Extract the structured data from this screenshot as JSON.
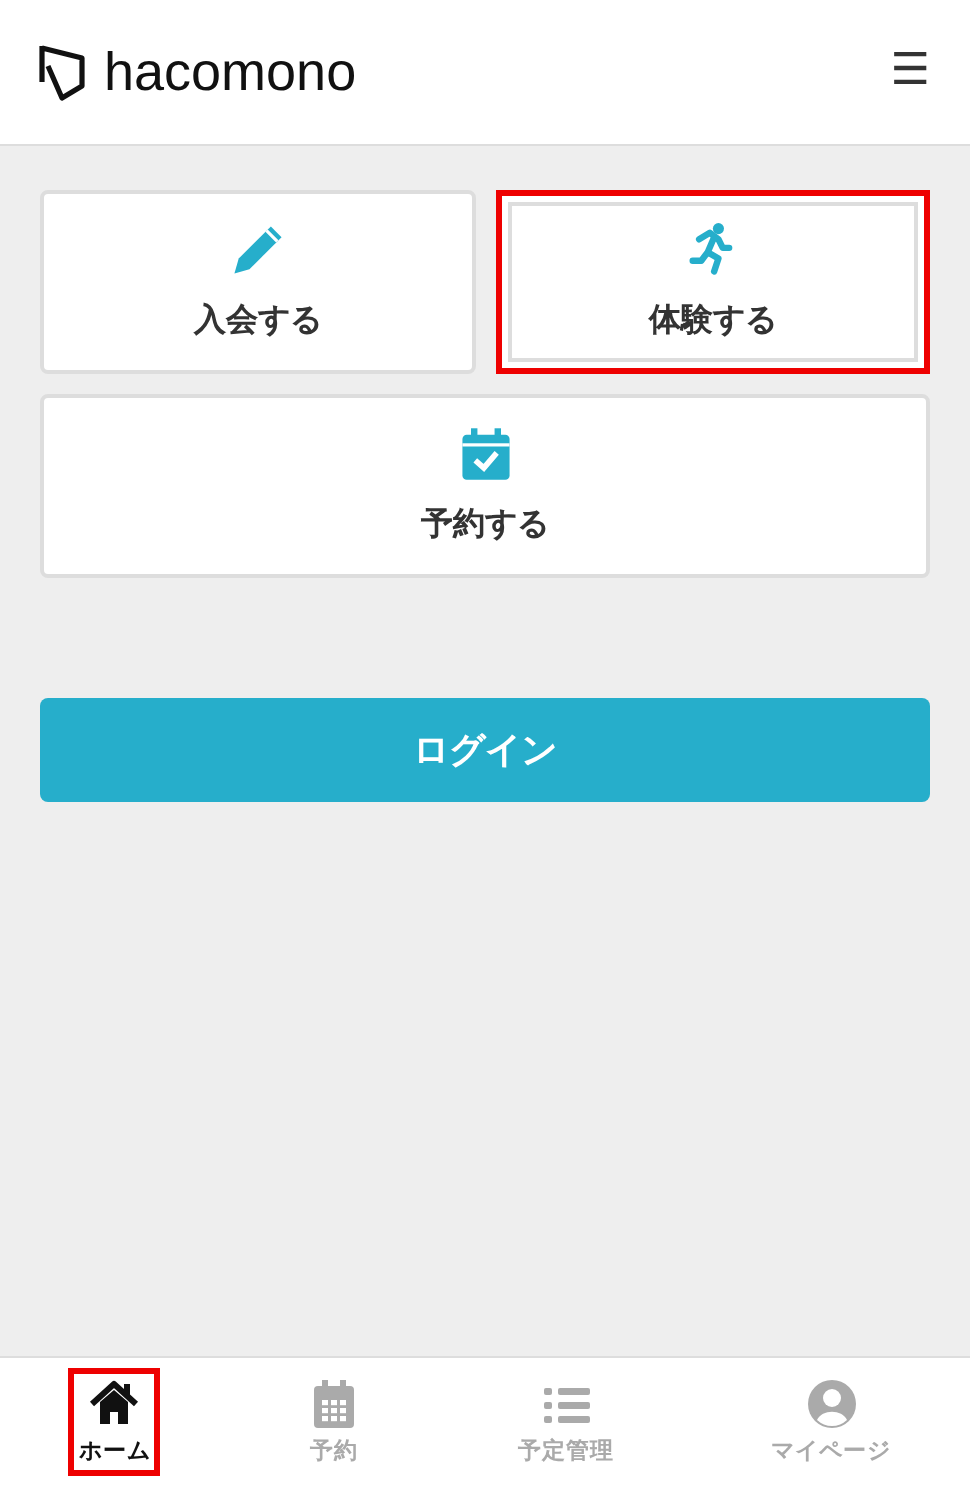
{
  "header": {
    "logo_text": "hacomono",
    "menu_icon": "☰"
  },
  "actions": [
    {
      "label": "入会する",
      "kind": "pencil",
      "highlighted": false,
      "wide": false
    },
    {
      "label": "体験する",
      "kind": "runner",
      "highlighted": true,
      "wide": false
    },
    {
      "label": "予約する",
      "kind": "calendar-check",
      "highlighted": false,
      "wide": true
    }
  ],
  "login_button": {
    "label": "ログイン"
  },
  "bottom_nav": [
    {
      "label": "ホーム",
      "kind": "home",
      "selected": true,
      "highlighted": true
    },
    {
      "label": "予約",
      "kind": "calendar",
      "selected": false,
      "highlighted": false
    },
    {
      "label": "予定管理",
      "kind": "list",
      "selected": false,
      "highlighted": false
    },
    {
      "label": "マイページ",
      "kind": "user",
      "selected": false,
      "highlighted": false
    }
  ]
}
